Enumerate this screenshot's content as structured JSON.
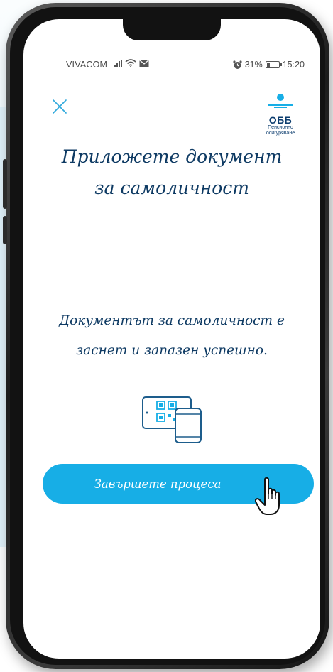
{
  "status_bar": {
    "carrier": "VIVACOM",
    "battery_percent": "31%",
    "time": "15:20",
    "battery_level": 0.31,
    "icons": [
      "signal-icon",
      "wifi-icon",
      "mail-icon",
      "alarm-icon",
      "battery-icon"
    ]
  },
  "header": {
    "close_icon": "close-icon",
    "logo_text": "ОББ",
    "logo_subtitle_line1": "Пенсионно",
    "logo_subtitle_line2": "осигуряване"
  },
  "main": {
    "title_line1": "Приложете документ",
    "title_line2": "за самоличност",
    "message_line1": "Документът за самоличност е",
    "message_line2": "заснет и запазен успешно.",
    "illustration_icon": "id-document-qr-icon",
    "primary_button_label": "Завършете процеса",
    "cursor_icon": "hand-pointer-icon"
  },
  "colors": {
    "accent": "#17aee6",
    "heading": "#0e3a63",
    "brand": "#0b3c6e",
    "close_icon": "#2ea8dc"
  }
}
